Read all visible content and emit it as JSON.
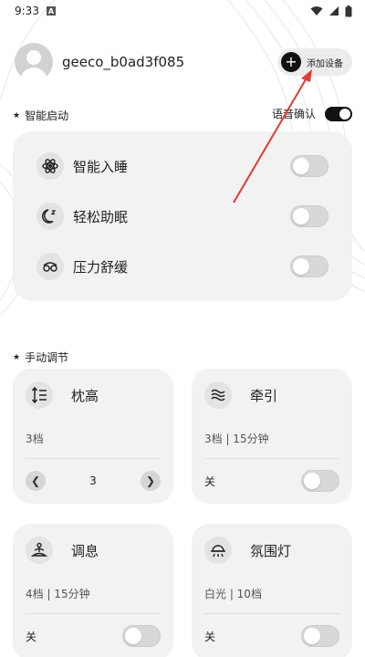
{
  "status_bar": {
    "time": "9:33",
    "notif_letter": "A"
  },
  "header": {
    "username": "geeco_b0ad3f085",
    "add_device_label": "添加设备"
  },
  "smart_start": {
    "title": "智能启动",
    "voice_confirm_label": "语音确认",
    "voice_confirm_on": true,
    "items": [
      {
        "label": "智能入睡",
        "icon": "atom-icon",
        "on": false
      },
      {
        "label": "轻松助眠",
        "icon": "moon-icon",
        "on": false
      },
      {
        "label": "压力舒缓",
        "icon": "glasses-icon",
        "on": false
      }
    ]
  },
  "manual": {
    "title": "手动调节",
    "tiles": [
      {
        "title": "枕高",
        "icon": "height-adjust-icon",
        "sub": "3档",
        "stepper_value": "3"
      },
      {
        "title": "牵引",
        "icon": "waves-icon",
        "sub": "3档 | 15分钟",
        "off_label": "关"
      },
      {
        "title": "调息",
        "icon": "meditation-icon",
        "sub": "4档 | 15分钟",
        "off_label": "关"
      },
      {
        "title": "氛围灯",
        "icon": "ambient-light-icon",
        "sub": "白光 | 10档",
        "off_label": "关"
      }
    ]
  },
  "colors": {
    "accent_arrow": "#e53935",
    "card_bg": "#f2f2f2",
    "toggle_on": "#111111"
  }
}
